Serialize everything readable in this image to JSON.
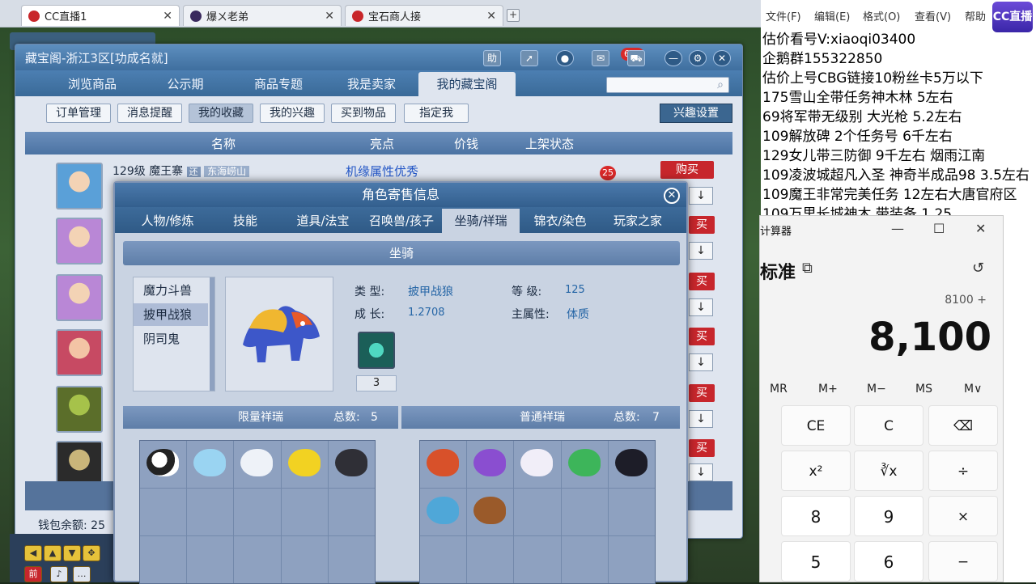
{
  "browser": {
    "tabs": [
      {
        "label": "CC直播1",
        "active": true
      },
      {
        "label": "爆ㄨ老弟",
        "active": false
      },
      {
        "label": "宝石商人接",
        "active": false
      }
    ],
    "close_glyph": "✕",
    "new_tab_glyph": "+"
  },
  "cbg": {
    "title": "藏宝阁-浙江3区[功成名就]",
    "help_label": "助",
    "message_count": "681",
    "nav_tabs": [
      "浏览商品",
      "公示期",
      "商品专题",
      "我是卖家",
      "我的藏宝阁"
    ],
    "nav_selected": "我的藏宝阁",
    "sub_buttons": [
      "订单管理",
      "消息提醒",
      "我的收藏",
      "我的兴趣",
      "买到物品",
      "指定我"
    ],
    "sub_selected": "我的收藏",
    "interest_settings": "兴趣设置",
    "columns": [
      "名称",
      "亮点",
      "价钱",
      "上架状态"
    ],
    "first_row": {
      "level": "129级",
      "name": "魔王寨",
      "tag": "还",
      "server": "东海崂山",
      "highlight": "机缘属性优秀",
      "badge": "25"
    },
    "buy_label": "购买",
    "buy_partial": "买",
    "arrow_glyph": "↓",
    "wallet_label": "钱包余额: 25"
  },
  "popup": {
    "title": "角色寄售信息",
    "close_glyph": "✕",
    "tabs": [
      "人物/修炼",
      "技能",
      "道具/法宝",
      "召唤兽/孩子",
      "坐骑/祥瑞",
      "锦衣/染色",
      "玩家之家"
    ],
    "tab_selected": "坐骑/祥瑞",
    "section_title": "坐骑",
    "mounts": [
      "魔力斗兽",
      "披甲战狼",
      "阴司鬼"
    ],
    "mount_selected": "披甲战狼",
    "fields": {
      "type_label": "类  型:",
      "type_value": "披甲战狼",
      "level_label": "等  级:",
      "level_value": "125",
      "growth_label": "成  长:",
      "growth_value": "1.2708",
      "attr_label": "主属性:",
      "attr_value": "体质"
    },
    "skill_count": "3",
    "limited": {
      "title": "限量祥瑞",
      "total_label": "总数:",
      "total": "5"
    },
    "normal": {
      "title": "普通祥瑞",
      "total_label": "总数:",
      "total": "7"
    }
  },
  "notepad": {
    "menu": [
      "文件(F)",
      "编辑(E)",
      "格式(O)",
      "查看(V)",
      "帮助"
    ],
    "logo_text": "CC直播",
    "lines": [
      "估价看号V:xiaoqi03400",
      "企鹅群155322850",
      "估价上号CBG链接10粉丝卡5万以下",
      "175雪山全带任务神木林 5左右",
      "69将军带无级别 大光枪 5.2左右",
      "109解放碑 2个任务号 6千左右",
      "129女儿带三防御 9千左右 烟雨江南",
      "109凌波城超凡入圣 神奇半成品98 3.5左右",
      "109魔王非常完美任务 12左右大唐官府区",
      "109万里长城神木 带装备 1.25"
    ]
  },
  "calculator": {
    "title": "计算器",
    "minimize": "—",
    "maximize": "☐",
    "close": "✕",
    "mode": "标准",
    "expression": "8100 +",
    "display": "8,100",
    "memory": [
      "MR",
      "M+",
      "M−",
      "MS",
      "M∨"
    ],
    "keys_row1": [
      "CE",
      "C",
      "⌫"
    ],
    "keys_row2": [
      "x²",
      "∛x",
      "÷"
    ],
    "keys_row3": [
      "8",
      "9",
      "×"
    ],
    "keys_row4": [
      "5",
      "6",
      "−"
    ]
  },
  "colors": {
    "accent_blue": "#3f6f9f",
    "buy_red": "#c7262c",
    "value_blue": "#2666a6"
  }
}
